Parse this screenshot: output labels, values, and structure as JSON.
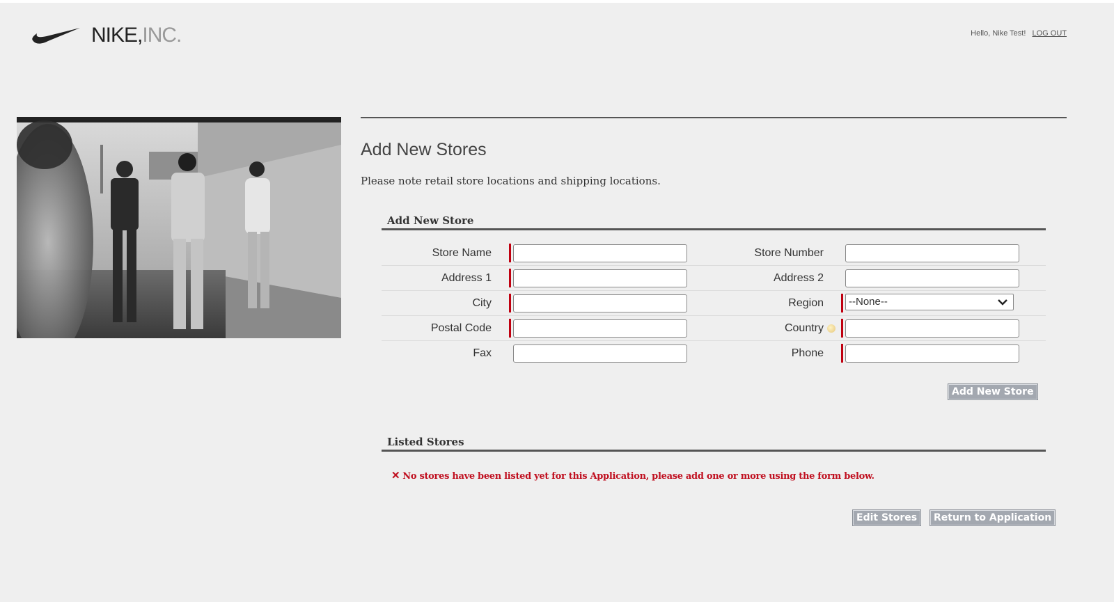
{
  "header": {
    "logo_text": "NIKE,",
    "logo_text_inc": "INC.",
    "greeting": "Hello, Nike Test!",
    "logout_label": "LOG OUT"
  },
  "page": {
    "title": "Add New Stores",
    "subtitle": "Please note retail store locations and shipping locations."
  },
  "add_store": {
    "section_title": "Add New Store",
    "fields": {
      "store_name": {
        "label": "Store Name",
        "value": ""
      },
      "store_number": {
        "label": "Store Number",
        "value": ""
      },
      "address1": {
        "label": "Address 1",
        "value": ""
      },
      "address2": {
        "label": "Address 2",
        "value": ""
      },
      "city": {
        "label": "City",
        "value": ""
      },
      "region": {
        "label": "Region",
        "value": "--None--"
      },
      "postal_code": {
        "label": "Postal Code",
        "value": ""
      },
      "country": {
        "label": "Country",
        "value": ""
      },
      "fax": {
        "label": "Fax",
        "value": ""
      },
      "phone": {
        "label": "Phone",
        "value": ""
      }
    },
    "submit_label": "Add New Store"
  },
  "listed_stores": {
    "section_title": "Listed Stores",
    "error_message": "No stores have been listed yet for this Application, please add one or more using the form below.",
    "edit_label": "Edit Stores",
    "return_label": "Return to Application"
  },
  "colors": {
    "required": "#c00010",
    "button": "#a3a8b0",
    "error": "#c01020"
  }
}
